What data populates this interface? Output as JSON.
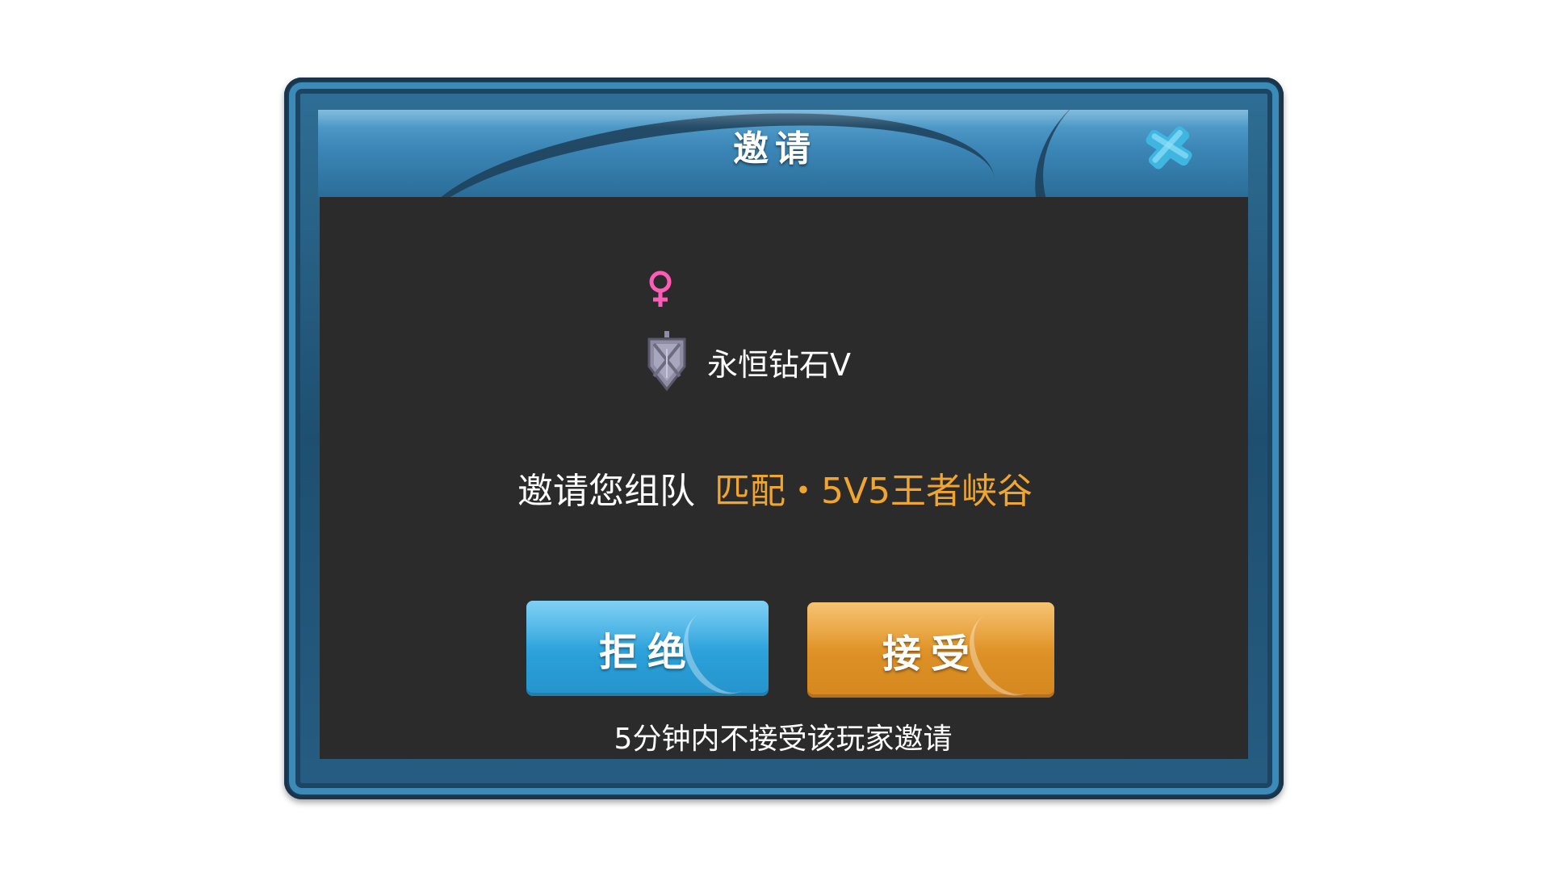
{
  "dialog": {
    "title": "邀请",
    "close_icon": "close-x-icon"
  },
  "player": {
    "gender_icon": "female-symbol-icon",
    "rank_icon": "diamond-rank-badge-icon",
    "rank": "永恒钻石V"
  },
  "invite": {
    "prefix": "邀请您组队",
    "mode": "匹配・5V5王者峡谷"
  },
  "buttons": {
    "reject": "拒绝",
    "accept": "接受"
  },
  "note": "5分钟内不接受该玩家邀请",
  "colors": {
    "frame": "#2f6f96",
    "panel": "#2b2b2b",
    "reject": "#2a9fd8",
    "accept": "#dc8f24",
    "mode_text": "#f0a531",
    "gender": "#ff5cb8",
    "close": "#4cc3ea"
  }
}
